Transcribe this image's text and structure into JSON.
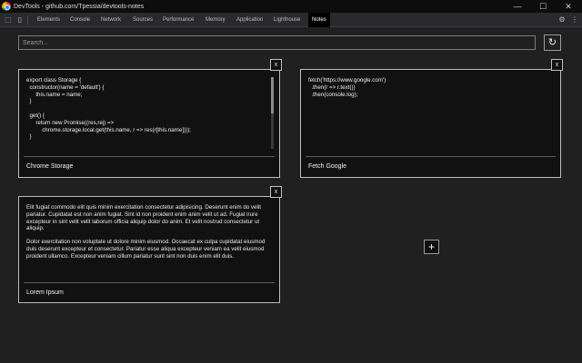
{
  "window": {
    "title": "DevTools - github.com/Tpessia/devtools-notes",
    "controls": {
      "minimize": "—",
      "maximize": "☐",
      "close": "✕"
    }
  },
  "toolbar": {
    "inspect_icon": "inspect-element-icon",
    "device_icon": "device-toolbar-icon",
    "settings_icon": "gear-icon",
    "tabs": [
      "Elements",
      "Console",
      "Network",
      "Sources",
      "Performance",
      "Memory",
      "Application",
      "Lighthouse",
      "Notes"
    ],
    "active_tab": "Notes"
  },
  "search": {
    "placeholder": "Search...",
    "value": "",
    "refresh_icon": "↻"
  },
  "notes": [
    {
      "close_label": "x",
      "title": "Chrome Storage",
      "content_lines": [
        "export class Storage {",
        "  constructor(name = 'default') {",
        "      this.name = name;",
        "  }",
        "",
        "  get() {",
        "      return new Promise((res,rej) =>",
        "          chrome.storage.local.get(this.name, r => res(r[this.name])));",
        "  }"
      ]
    },
    {
      "close_label": "x",
      "title": "Fetch Google",
      "content_lines": [
        "fetch('https://www.google.com')",
        "  .then(r => r.text())",
        "  .then(console.log);"
      ]
    },
    {
      "close_label": "x",
      "title": "Lorem Ipsum",
      "paragraphs": [
        "Elit fugiat commodo elit quis minim exercitation consectetur adipisicing. Deserunt enim do velit pariatur. Cupidatat est non anim fugiat. Sint id non proident enim anim velit ut ad. Fugiat irure excepteur in sint velit velit laborum officia aliquip dolor do anim. Et velit nostrud consectetur ut aliquip.",
        "Dolor exercitation non voluptate ut dolore minim eiusmod. Occaecat ex culpa cupidatat eiusmod duis deserunt excepteur et consectetur. Pariatur esse aliqua excepteur veniam ea velit eiusmod proident ullamco. Excepteur veniam cillum pariatur sunt sint non duis enim elit duis."
      ]
    }
  ],
  "add_note": {
    "label": "+"
  }
}
